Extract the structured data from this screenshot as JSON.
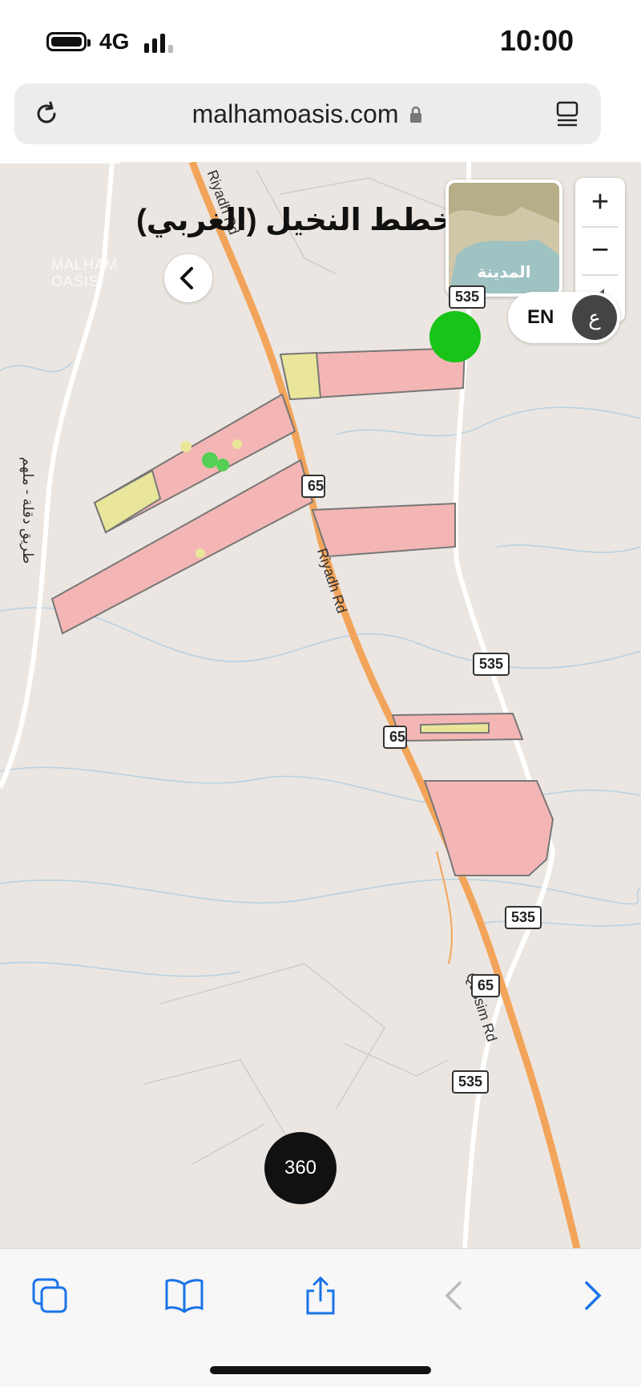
{
  "status": {
    "network": "4G",
    "time": "10:00"
  },
  "browser": {
    "url": "malhamoasis.com"
  },
  "map": {
    "title": "مخطط النخيل (الغربي)",
    "minimap_label": "المدينة",
    "lang_en": "EN",
    "lang_ar": "ع",
    "btn_360": "360",
    "shields": [
      "535",
      "65",
      "535",
      "65",
      "535",
      "65",
      "535"
    ],
    "road_labels": [
      "Riyadh Rd",
      "Riyadh Rd",
      "Qassim Rd",
      "طريق دقلة - ملهم"
    ],
    "watermark": "MALHAM OASIS",
    "zoom_in": "+",
    "zoom_out": "−"
  },
  "colors": {
    "road": "#f2a45a",
    "plot": "#f3b6b4",
    "plot_yellow": "#e9e59a",
    "plot_green": "#55d055",
    "accent": "#1a73e8"
  },
  "icons": [
    "reload-icon",
    "reader-icon",
    "back-chevron-icon",
    "tabs-icon",
    "bookmarks-icon",
    "share-icon",
    "nav-back-icon",
    "nav-forward-icon"
  ]
}
